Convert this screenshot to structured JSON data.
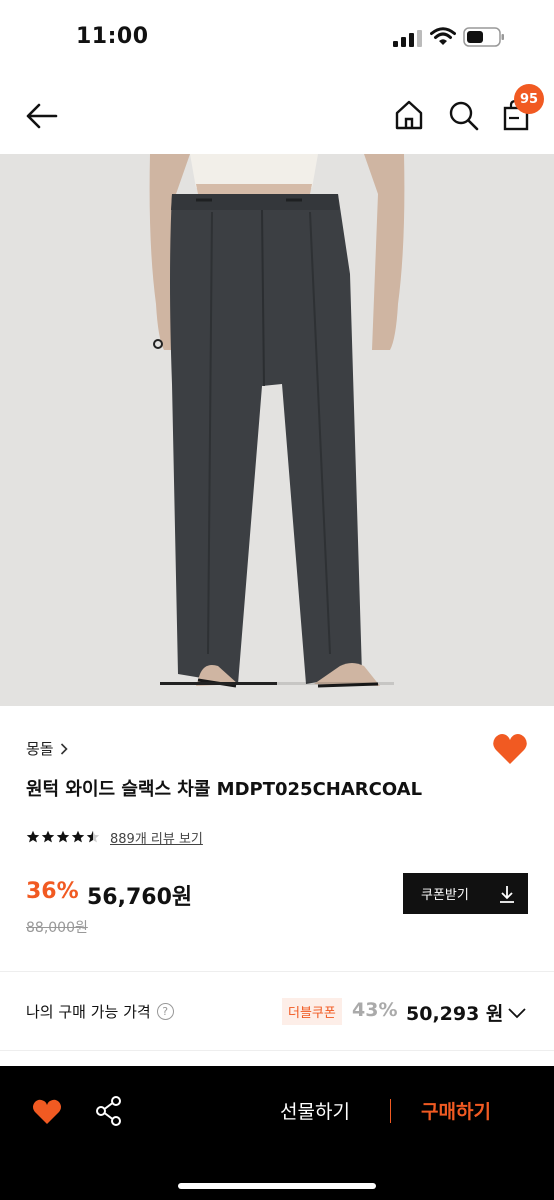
{
  "status_bar": {
    "time": "11:00"
  },
  "header": {
    "cart_count": "95"
  },
  "product": {
    "image_position": 0.5,
    "brand": "몽돌",
    "title": "원턱 와이드 슬랙스 차콜 MDPT025CHARCOAL",
    "rating": 4.5,
    "review_link": "889개 리뷰 보기",
    "discount_rate": "36%",
    "price": "56,760원",
    "original_price": "88,000원",
    "coupon_button": "쿠폰받기"
  },
  "my_price": {
    "label": "나의 구매 가능 가격",
    "help": "?",
    "coupon_tag": "더블쿠폰",
    "discount_rate": "43%",
    "price": "50,293 원"
  },
  "bottom_bar": {
    "gift_label": "선물하기",
    "buy_label": "구매하기"
  },
  "colors": {
    "accent": "#f15a22",
    "dark": "#111111",
    "image_bg": "#e3e2e0"
  }
}
